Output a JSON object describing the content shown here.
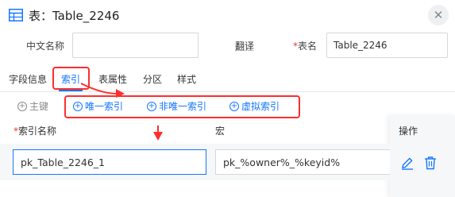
{
  "dialog": {
    "title": "表：Table_2246",
    "close_icon": "close-icon"
  },
  "form": {
    "cn_name_label": "中文名称",
    "cn_name_value": "",
    "translate_label": "翻译",
    "required_mark": "*",
    "table_name_label": "表名",
    "table_name_value": "Table_2246"
  },
  "tabs": [
    {
      "label": "字段信息",
      "active": false
    },
    {
      "label": "索引",
      "active": true
    },
    {
      "label": "表属性",
      "active": false
    },
    {
      "label": "分区",
      "active": false
    },
    {
      "label": "样式",
      "active": false
    }
  ],
  "toolbar": {
    "primary_key": "主键",
    "unique_index": "唯一索引",
    "non_unique_index": "非唯一索引",
    "virtual_index": "虚拟索引",
    "add_icon": "+"
  },
  "table": {
    "headers": {
      "index_name": "索引名称",
      "macro": "宏",
      "actions": "操作"
    },
    "rows": [
      {
        "index_name": "pk_Table_2246_1",
        "macro": "pk_%owner%_%keyid%"
      }
    ]
  },
  "colors": {
    "accent": "#1677ff",
    "highlight": "#ff2d2d",
    "required": "#e53935"
  }
}
